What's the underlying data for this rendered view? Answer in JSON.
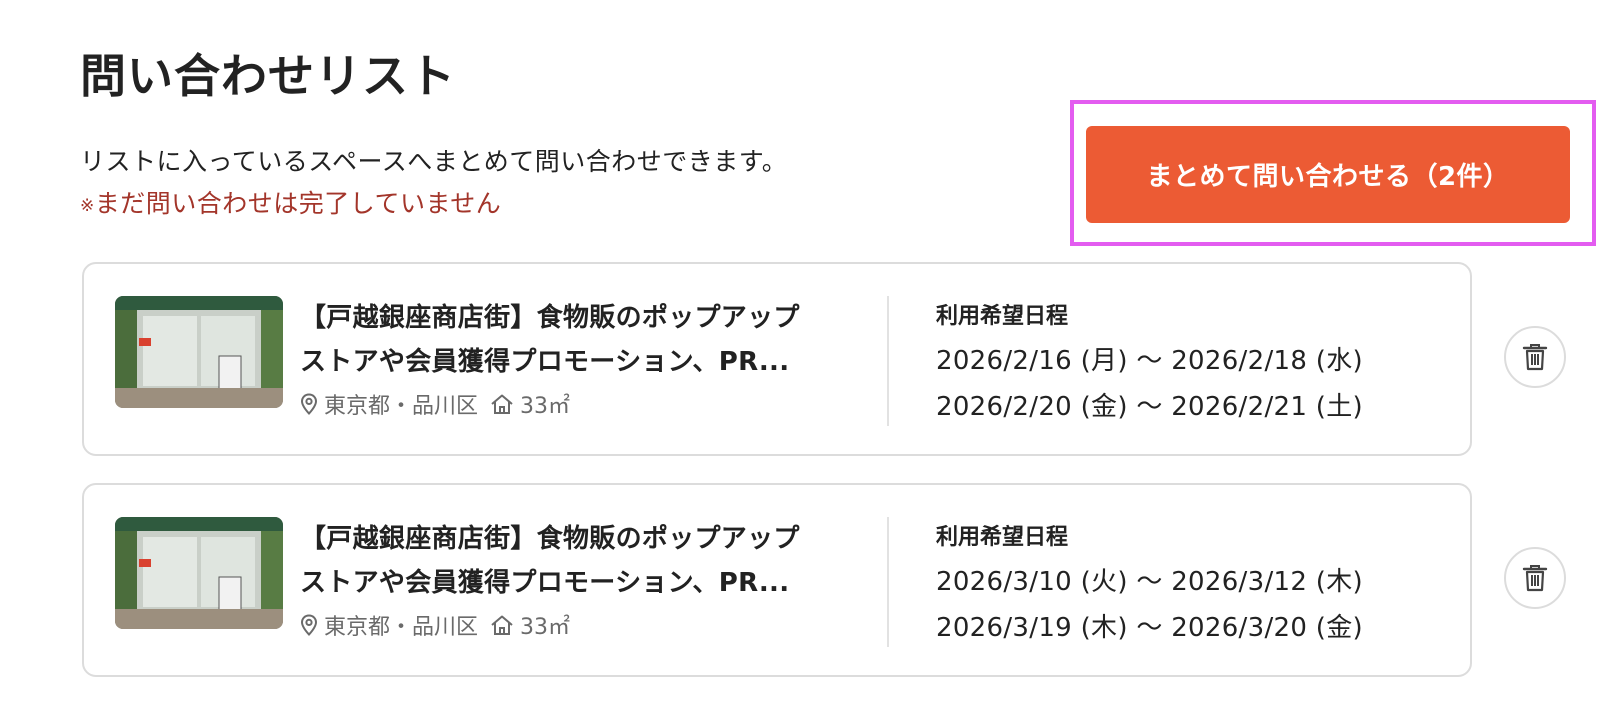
{
  "header": {
    "title": "問い合わせリスト",
    "description": "リストに入っているスペースへまとめて問い合わせできます。",
    "warning_mark": "※",
    "warning_text": "まだ問い合わせは完了していません"
  },
  "bulk_contact_button": {
    "label": "まとめて問い合わせる（2件）"
  },
  "schedule_label": "利用希望日程",
  "items": [
    {
      "title_line1": "【戸越銀座商店街】食物販のポップアップ",
      "title_line2": "ストアや会員獲得プロモーション、PR...",
      "location": "東京都・品川区",
      "area": "33㎡",
      "dates": [
        "2026/2/16 (月) 〜 2026/2/18 (水)",
        "2026/2/20 (金) 〜 2026/2/21 (土)"
      ]
    },
    {
      "title_line1": "【戸越銀座商店街】食物販のポップアップ",
      "title_line2": "ストアや会員獲得プロモーション、PR...",
      "location": "東京都・品川区",
      "area": "33㎡",
      "dates": [
        "2026/3/10 (火) 〜 2026/3/12 (木)",
        "2026/3/19 (木) 〜 2026/3/20 (金)"
      ]
    }
  ],
  "icons": {
    "location": "map-pin-icon",
    "area": "house-icon",
    "delete": "trash-icon"
  },
  "colors": {
    "accent": "#ec5b34",
    "warning": "#a3352a",
    "highlight": "#e35cf0"
  }
}
